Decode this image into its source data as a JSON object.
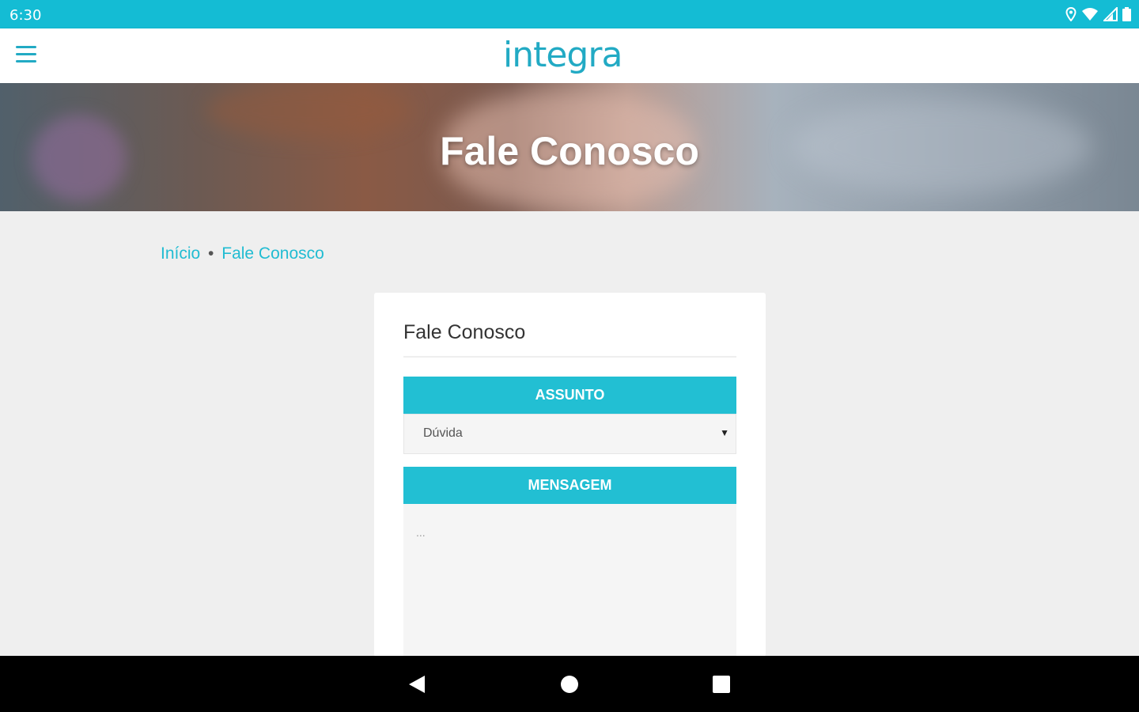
{
  "status_bar": {
    "time": "6:30",
    "icons": [
      "location-icon",
      "wifi-icon",
      "signal-icon",
      "battery-icon"
    ],
    "color": "#14bcd4"
  },
  "app_bar": {
    "logo_text": "integra",
    "menu_icon": "hamburger-menu-icon"
  },
  "hero": {
    "title": "Fale Conosco"
  },
  "breadcrumb": {
    "home": "Início",
    "separator": "•",
    "current": "Fale Conosco"
  },
  "form": {
    "title": "Fale Conosco",
    "subject_header": "ASSUNTO",
    "subject_value": "Dúvida",
    "message_header": "MENSAGEM",
    "message_placeholder": "..."
  },
  "nav_bar": {
    "icons": [
      "back-icon",
      "home-icon",
      "recent-apps-icon"
    ]
  },
  "colors": {
    "accent": "#22bfd3",
    "status_bar": "#14bcd4",
    "link": "#21bcd2"
  }
}
